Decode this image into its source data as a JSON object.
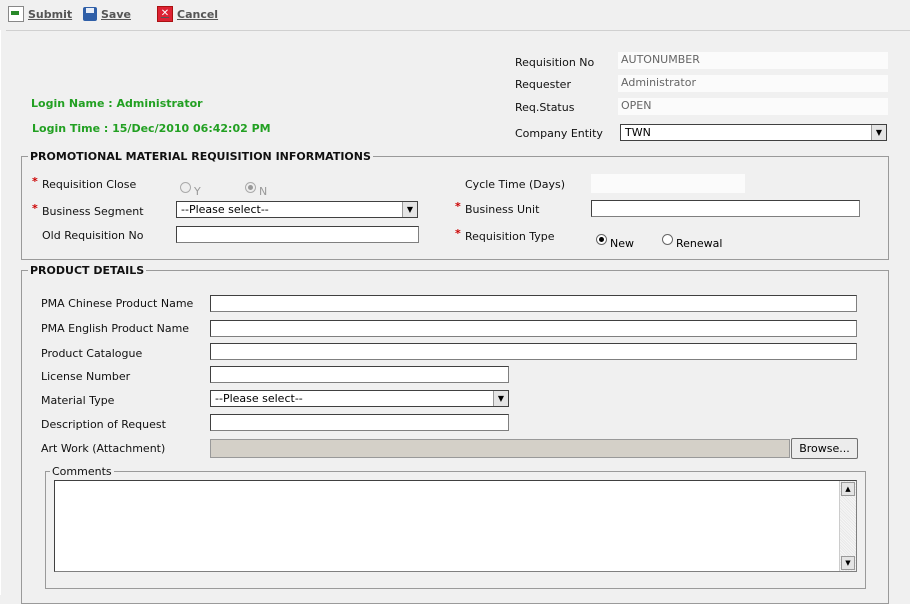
{
  "toolbar": {
    "submit": "Submit",
    "save": "Save",
    "cancel": "Cancel"
  },
  "login": {
    "name": "Login Name : Administrator",
    "time": "Login Time : 15/Dec/2010 06:42:02 PM"
  },
  "header": {
    "requisition_no_label": "Requisition No",
    "requisition_no_value": "AUTONUMBER",
    "requester_label": "Requester",
    "requester_value": "Administrator",
    "status_label": "Req.Status",
    "status_value": "OPEN",
    "company_label": "Company Entity",
    "company_value": "TWN"
  },
  "promo": {
    "legend": "PROMOTIONAL MATERIAL REQUISITION INFORMATIONS",
    "required_mark": "*",
    "req_close_label": "Requisition Close",
    "req_close_y": "Y",
    "req_close_n": "N",
    "cycle_label": "Cycle Time (Days)",
    "segment_label": "Business Segment",
    "segment_value": "--Please select--",
    "unit_label": "Business Unit",
    "old_req_label": "Old Requisition No",
    "req_type_label": "Requisition Type",
    "type_new": "New",
    "type_renewal": "Renewal"
  },
  "product": {
    "legend": "PRODUCT DETAILS",
    "cn_name_label": "PMA Chinese Product Name",
    "en_name_label": "PMA English Product Name",
    "catalogue_label": "Product Catalogue",
    "license_label": "License Number",
    "material_label": "Material Type",
    "material_value": "--Please select--",
    "desc_label": "Description of Request",
    "artwork_label": "Art Work (Attachment)",
    "browse": "Browse...",
    "comments_legend": "Comments"
  }
}
